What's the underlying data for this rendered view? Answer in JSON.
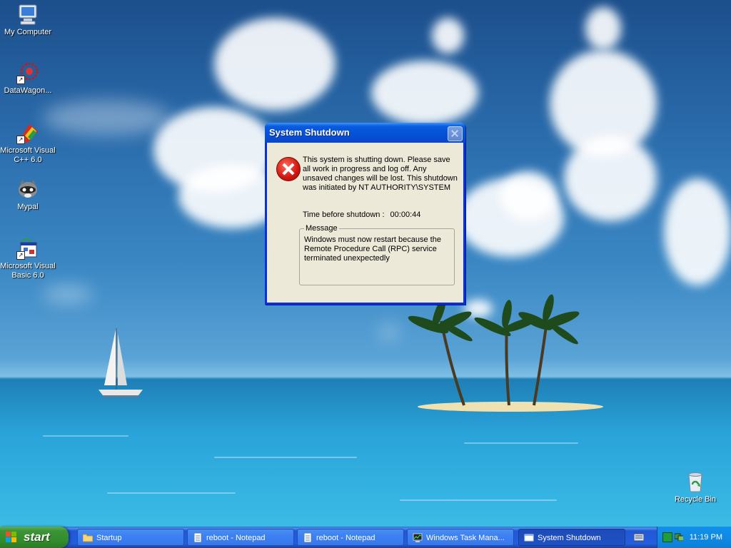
{
  "desktop": {
    "icons": [
      {
        "label": "My Computer",
        "icon": "my-computer-icon"
      },
      {
        "label": "DataWagon...",
        "icon": "datawagon-icon"
      },
      {
        "label": "Microsoft Visual C++ 6.0",
        "icon": "visual-cpp-icon"
      },
      {
        "label": "Mypal",
        "icon": "mypal-raccoon-icon"
      },
      {
        "label": "Microsoft Visual Basic 6.0",
        "icon": "visual-basic-icon"
      }
    ],
    "recycle_bin": {
      "label": "Recycle Bin",
      "icon": "recycle-bin-icon"
    }
  },
  "dialog": {
    "title": "System Shutdown",
    "message": "This system is shutting down. Please save all work in progress and log off. Any unsaved changes will be lost. This shutdown was initiated by NT AUTHORITY\\SYSTEM",
    "time_label": "Time before shutdown :",
    "time_value": "00:00:44",
    "group_label": "Message",
    "group_text": "Windows must now restart because the Remote Procedure Call (RPC) service terminated unexpectedly",
    "icon": "error-icon"
  },
  "taskbar": {
    "start_label": "start",
    "tasks": [
      {
        "label": "Startup",
        "icon": "folder-icon",
        "active": false
      },
      {
        "label": "reboot - Notepad",
        "icon": "notepad-icon",
        "active": false
      },
      {
        "label": "reboot - Notepad",
        "icon": "notepad-icon",
        "active": false
      },
      {
        "label": "Windows Task Mana...",
        "icon": "task-manager-icon",
        "active": false
      },
      {
        "label": "System Shutdown",
        "icon": "window-icon",
        "active": true
      }
    ],
    "clock": "11:19 PM"
  },
  "colors": {
    "title_bar": "#0551d8",
    "dialog_face": "#ece9d8",
    "start_green": "#3c9436",
    "taskbar_blue": "#245edb",
    "tray_blue": "#0f8ae4"
  }
}
